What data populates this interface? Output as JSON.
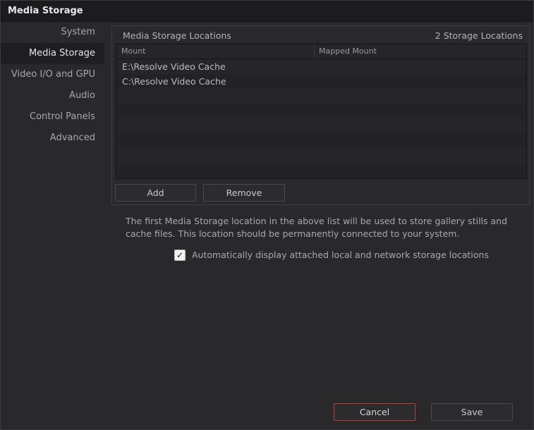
{
  "window": {
    "title": "Media Storage"
  },
  "sidebar": {
    "items": [
      {
        "label": "System",
        "active": false
      },
      {
        "label": "Media Storage",
        "active": true
      },
      {
        "label": "Video I/O and GPU",
        "active": false
      },
      {
        "label": "Audio",
        "active": false
      },
      {
        "label": "Control Panels",
        "active": false
      },
      {
        "label": "Advanced",
        "active": false
      }
    ]
  },
  "storage_panel": {
    "title": "Media Storage Locations",
    "count_label": "2 Storage Locations",
    "columns": {
      "mount": "Mount",
      "mapped_mount": "Mapped Mount"
    },
    "rows": [
      {
        "mount": "E:\\Resolve Video Cache",
        "mapped_mount": ""
      },
      {
        "mount": "C:\\Resolve Video Cache",
        "mapped_mount": ""
      }
    ],
    "add_label": "Add",
    "remove_label": "Remove"
  },
  "info_text": "The first Media Storage location in the above list will be used to store gallery stills and cache files. This location should be permanently connected to your system.",
  "auto_display": {
    "checked": true,
    "label": "Automatically display attached local and network storage locations"
  },
  "footer": {
    "cancel_label": "Cancel",
    "save_label": "Save"
  },
  "colors": {
    "accent_cancel_border": "#c0393b",
    "background": "#29292c",
    "titlebar": "#1c1c1e"
  },
  "icons": {
    "checkbox_mark": "check-icon"
  }
}
